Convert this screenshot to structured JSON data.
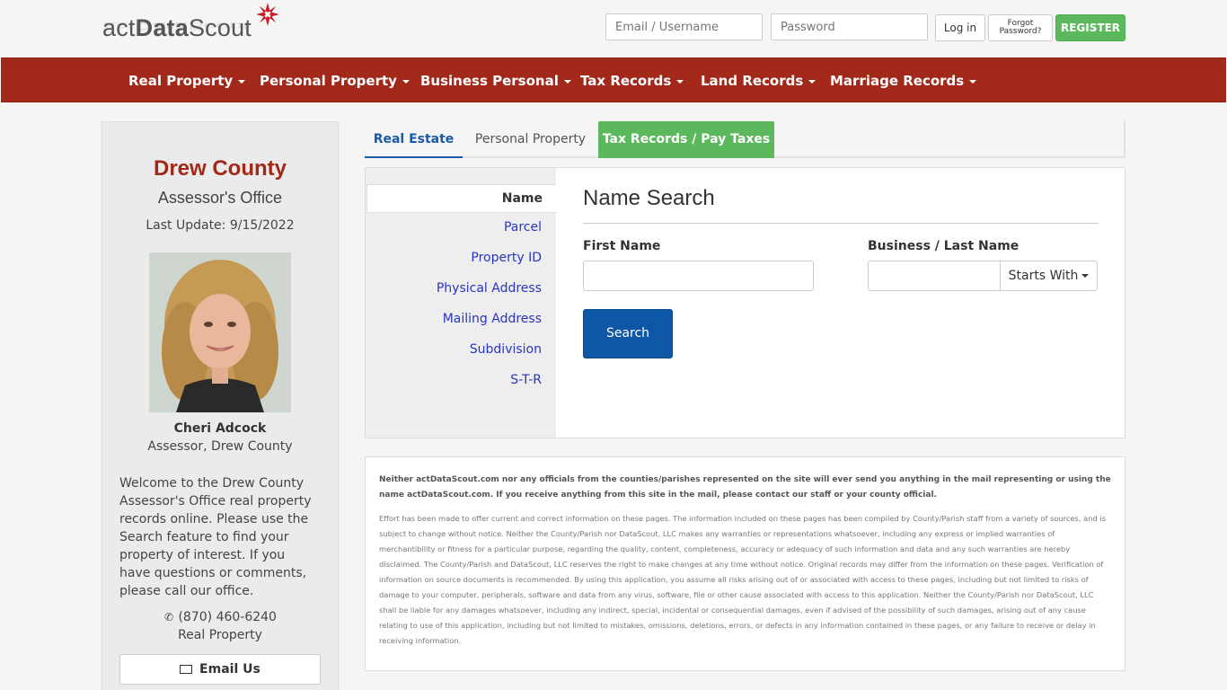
{
  "header": {
    "logo_text_light": "act",
    "logo_text_bold": "Data",
    "logo_text_end": "Scout",
    "email_placeholder": "Email / Username",
    "password_placeholder": "Password",
    "login_label": "Log in",
    "forgot_label": "Forgot\nPassword?",
    "register_label": "REGISTER"
  },
  "nav": {
    "items": [
      {
        "label": "Real Property"
      },
      {
        "label": "Personal Property"
      },
      {
        "label": "Business Personal"
      },
      {
        "label": "Tax Records"
      },
      {
        "label": "Land Records"
      },
      {
        "label": "Marriage Records"
      }
    ]
  },
  "sidebar": {
    "county": "Drew County",
    "office": "Assessor's Office",
    "last_update": "Last Update: 9/15/2022",
    "assessor_name": "Cheri Adcock",
    "assessor_title": "Assessor, Drew County",
    "welcome": "Welcome to the Drew County Assessor's Office real property records online. Please use the Search feature to find your property of interest. If you have questions or comments, please call our office.",
    "phone": "(870) 460-6240",
    "phone_dept": "Real Property",
    "email_label": "Email Us"
  },
  "tabs": [
    {
      "label": "Real Estate"
    },
    {
      "label": "Personal Property"
    },
    {
      "label": "Tax Records / Pay Taxes"
    }
  ],
  "search_menu": {
    "active": "Name",
    "items": [
      {
        "label": "Parcel"
      },
      {
        "label": "Property ID"
      },
      {
        "label": "Physical Address"
      },
      {
        "label": "Mailing Address"
      },
      {
        "label": "Subdivision"
      },
      {
        "label": "S-T-R"
      }
    ]
  },
  "search": {
    "title": "Name Search",
    "first_name_label": "First Name",
    "last_name_label": "Business / Last Name",
    "match_mode": "Starts With",
    "button_label": "Search"
  },
  "disclaimer": {
    "notice": "Neither actDataScout.com nor any officials from the counties/parishes represented on the site will ever send you anything in the mail representing or using the name actDataScout.com. If you receive anything from this site in the mail, please contact our staff or your county official.",
    "body": "Effort has been made to offer current and correct information on these pages. The information included on these pages has been compiled by County/Parish staff from a variety of sources, and is subject to change without notice. Neither the County/Parish nor DataScout, LLC makes any warranties or representations whatsoever, including any express or implied warranties of merchantibility or fitness for a particular purpose, regarding the quality, content, completeness, accuracy or adequacy of such information and data and any such warranties are hereby disclaimed. The County/Parish and DataScout, LLC reserves the right to make changes at any time without notice. Original records may differ from the information on these pages. Verification of information on source documents is recommended. By using this application, you assume all risks arising out of or associated with access to these pages, including but not limited to risks of damage to your computer, peripherals, software and data from any virus, software, file or other cause associated with access to this application. Neither the County/Parish nor DataScout, LLC shall be liable for any damages whatsoever, including any indirect, special, incidental or consequential damages, even if advised of the possibility of such damages, arising out of any cause relating to use of this application, including but not limited to mistakes, omissions, deletions, errors, or defects in any information contained in these pages, or any failure to receive or delay in receiving information."
  },
  "colors": {
    "brand_red": "#a2281a",
    "link_blue": "#2a35c0",
    "green": "#5cb85c",
    "primary_blue": "#0d57a6"
  }
}
